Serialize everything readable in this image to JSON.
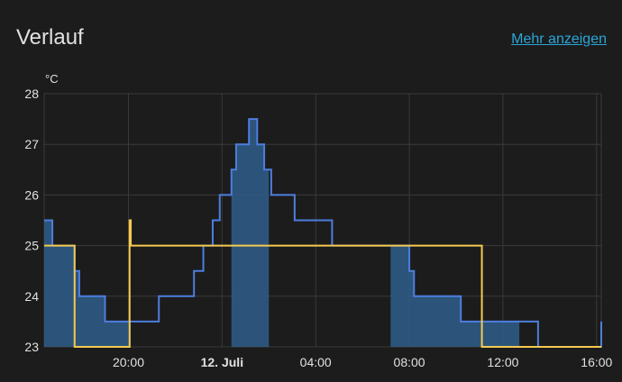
{
  "card": {
    "title": "Verlauf",
    "more_link": "Mehr anzeigen"
  },
  "colors": {
    "background": "#1c1c1c",
    "current_line": "#4d7ede",
    "current_fill": "#2f5e8c",
    "target_line": "#f5c94f",
    "grid": "#3a3a3a",
    "link": "#2aa7d8"
  },
  "chart_data": {
    "type": "line",
    "step": true,
    "unit": "°C",
    "ylim": [
      23,
      28
    ],
    "yticks": [
      "23",
      "24",
      "25",
      "26",
      "27",
      "28"
    ],
    "xlim": [
      16.4,
      40.2
    ],
    "xticks": [
      {
        "hour": 20,
        "label": "20:00",
        "bold": false
      },
      {
        "hour": 24,
        "label": "12. Juli",
        "bold": true
      },
      {
        "hour": 28,
        "label": "04:00",
        "bold": false
      },
      {
        "hour": 32,
        "label": "08:00",
        "bold": false
      },
      {
        "hour": 36,
        "label": "12:00",
        "bold": false
      },
      {
        "hour": 40,
        "label": "16:00",
        "bold": false
      }
    ],
    "grid": true,
    "series": [
      {
        "key": "current",
        "points": [
          [
            16.4,
            25.5
          ],
          [
            16.75,
            25.0
          ],
          [
            17.7,
            24.5
          ],
          [
            17.9,
            24.0
          ],
          [
            18.6,
            24.0
          ],
          [
            19.0,
            23.5
          ],
          [
            20.1,
            23.5
          ],
          [
            20.6,
            23.5
          ],
          [
            21.3,
            24.0
          ],
          [
            22.2,
            24.0
          ],
          [
            22.8,
            24.5
          ],
          [
            23.2,
            25.0
          ],
          [
            23.6,
            25.5
          ],
          [
            23.9,
            26.0
          ],
          [
            24.4,
            26.5
          ],
          [
            24.6,
            27.0
          ],
          [
            25.15,
            27.5
          ],
          [
            25.5,
            27.0
          ],
          [
            25.8,
            26.5
          ],
          [
            26.1,
            26.0
          ],
          [
            26.8,
            26.0
          ],
          [
            27.1,
            25.5
          ],
          [
            28.1,
            25.5
          ],
          [
            28.7,
            25.0
          ],
          [
            31.2,
            25.0
          ],
          [
            31.7,
            25.0
          ],
          [
            32.0,
            24.5
          ],
          [
            32.2,
            24.0
          ],
          [
            33.2,
            24.0
          ],
          [
            34.2,
            23.5
          ],
          [
            36.7,
            23.5
          ],
          [
            37.5,
            23.0
          ],
          [
            40.2,
            23.5
          ]
        ],
        "heating_intervals": [
          [
            16.4,
            20.1
          ],
          [
            24.4,
            26.0
          ],
          [
            31.2,
            36.7
          ]
        ]
      },
      {
        "key": "target",
        "points": [
          [
            16.4,
            25.0
          ],
          [
            17.7,
            23.0
          ],
          [
            20.05,
            25.5
          ],
          [
            20.1,
            25.0
          ],
          [
            35.1,
            23.0
          ],
          [
            40.2,
            23.0
          ]
        ]
      }
    ]
  }
}
